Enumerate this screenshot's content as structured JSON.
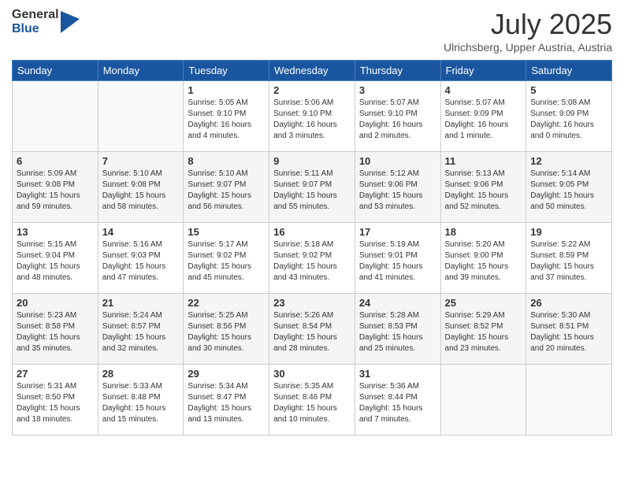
{
  "logo": {
    "general": "General",
    "blue": "Blue"
  },
  "header": {
    "month_year": "July 2025",
    "location": "Ulrichsberg, Upper Austria, Austria"
  },
  "weekdays": [
    "Sunday",
    "Monday",
    "Tuesday",
    "Wednesday",
    "Thursday",
    "Friday",
    "Saturday"
  ],
  "days": [
    {
      "num": "",
      "info": ""
    },
    {
      "num": "",
      "info": ""
    },
    {
      "num": "1",
      "info": "Sunrise: 5:05 AM\nSunset: 9:10 PM\nDaylight: 16 hours\nand 4 minutes."
    },
    {
      "num": "2",
      "info": "Sunrise: 5:06 AM\nSunset: 9:10 PM\nDaylight: 16 hours\nand 3 minutes."
    },
    {
      "num": "3",
      "info": "Sunrise: 5:07 AM\nSunset: 9:10 PM\nDaylight: 16 hours\nand 2 minutes."
    },
    {
      "num": "4",
      "info": "Sunrise: 5:07 AM\nSunset: 9:09 PM\nDaylight: 16 hours\nand 1 minute."
    },
    {
      "num": "5",
      "info": "Sunrise: 5:08 AM\nSunset: 9:09 PM\nDaylight: 16 hours\nand 0 minutes."
    },
    {
      "num": "6",
      "info": "Sunrise: 5:09 AM\nSunset: 9:08 PM\nDaylight: 15 hours\nand 59 minutes."
    },
    {
      "num": "7",
      "info": "Sunrise: 5:10 AM\nSunset: 9:08 PM\nDaylight: 15 hours\nand 58 minutes."
    },
    {
      "num": "8",
      "info": "Sunrise: 5:10 AM\nSunset: 9:07 PM\nDaylight: 15 hours\nand 56 minutes."
    },
    {
      "num": "9",
      "info": "Sunrise: 5:11 AM\nSunset: 9:07 PM\nDaylight: 15 hours\nand 55 minutes."
    },
    {
      "num": "10",
      "info": "Sunrise: 5:12 AM\nSunset: 9:06 PM\nDaylight: 15 hours\nand 53 minutes."
    },
    {
      "num": "11",
      "info": "Sunrise: 5:13 AM\nSunset: 9:06 PM\nDaylight: 15 hours\nand 52 minutes."
    },
    {
      "num": "12",
      "info": "Sunrise: 5:14 AM\nSunset: 9:05 PM\nDaylight: 15 hours\nand 50 minutes."
    },
    {
      "num": "13",
      "info": "Sunrise: 5:15 AM\nSunset: 9:04 PM\nDaylight: 15 hours\nand 48 minutes."
    },
    {
      "num": "14",
      "info": "Sunrise: 5:16 AM\nSunset: 9:03 PM\nDaylight: 15 hours\nand 47 minutes."
    },
    {
      "num": "15",
      "info": "Sunrise: 5:17 AM\nSunset: 9:02 PM\nDaylight: 15 hours\nand 45 minutes."
    },
    {
      "num": "16",
      "info": "Sunrise: 5:18 AM\nSunset: 9:02 PM\nDaylight: 15 hours\nand 43 minutes."
    },
    {
      "num": "17",
      "info": "Sunrise: 5:19 AM\nSunset: 9:01 PM\nDaylight: 15 hours\nand 41 minutes."
    },
    {
      "num": "18",
      "info": "Sunrise: 5:20 AM\nSunset: 9:00 PM\nDaylight: 15 hours\nand 39 minutes."
    },
    {
      "num": "19",
      "info": "Sunrise: 5:22 AM\nSunset: 8:59 PM\nDaylight: 15 hours\nand 37 minutes."
    },
    {
      "num": "20",
      "info": "Sunrise: 5:23 AM\nSunset: 8:58 PM\nDaylight: 15 hours\nand 35 minutes."
    },
    {
      "num": "21",
      "info": "Sunrise: 5:24 AM\nSunset: 8:57 PM\nDaylight: 15 hours\nand 32 minutes."
    },
    {
      "num": "22",
      "info": "Sunrise: 5:25 AM\nSunset: 8:56 PM\nDaylight: 15 hours\nand 30 minutes."
    },
    {
      "num": "23",
      "info": "Sunrise: 5:26 AM\nSunset: 8:54 PM\nDaylight: 15 hours\nand 28 minutes."
    },
    {
      "num": "24",
      "info": "Sunrise: 5:28 AM\nSunset: 8:53 PM\nDaylight: 15 hours\nand 25 minutes."
    },
    {
      "num": "25",
      "info": "Sunrise: 5:29 AM\nSunset: 8:52 PM\nDaylight: 15 hours\nand 23 minutes."
    },
    {
      "num": "26",
      "info": "Sunrise: 5:30 AM\nSunset: 8:51 PM\nDaylight: 15 hours\nand 20 minutes."
    },
    {
      "num": "27",
      "info": "Sunrise: 5:31 AM\nSunset: 8:50 PM\nDaylight: 15 hours\nand 18 minutes."
    },
    {
      "num": "28",
      "info": "Sunrise: 5:33 AM\nSunset: 8:48 PM\nDaylight: 15 hours\nand 15 minutes."
    },
    {
      "num": "29",
      "info": "Sunrise: 5:34 AM\nSunset: 8:47 PM\nDaylight: 15 hours\nand 13 minutes."
    },
    {
      "num": "30",
      "info": "Sunrise: 5:35 AM\nSunset: 8:46 PM\nDaylight: 15 hours\nand 10 minutes."
    },
    {
      "num": "31",
      "info": "Sunrise: 5:36 AM\nSunset: 8:44 PM\nDaylight: 15 hours\nand 7 minutes."
    },
    {
      "num": "",
      "info": ""
    },
    {
      "num": "",
      "info": ""
    },
    {
      "num": "",
      "info": ""
    }
  ]
}
